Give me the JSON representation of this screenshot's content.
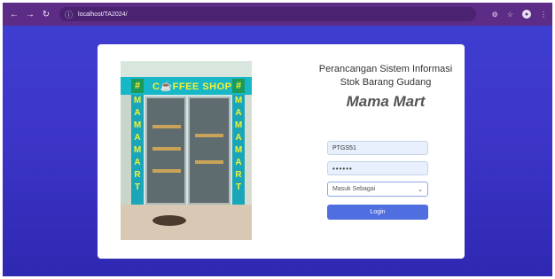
{
  "browser": {
    "url": "localhost/TA2024/",
    "icons": [
      "back-icon",
      "forward-icon",
      "reload-icon",
      "info-icon",
      "translate-icon",
      "star-icon",
      "extension-icon",
      "menu-icon"
    ],
    "bar_color": "#5d2c86"
  },
  "page": {
    "background": "#3d36c9",
    "title_line1": "Perancangan Sistem Informasi",
    "title_line2": "Stok Barang Gudang",
    "app_name": "Mama Mart",
    "photo": {
      "sign": "C☕FFEE SHOP",
      "column_text": [
        "M",
        "A",
        "M",
        "A",
        "M",
        "A",
        "R",
        "T"
      ],
      "hash": "#"
    }
  },
  "form": {
    "username_value": "PTGS51",
    "password_value": "••••••",
    "role_select": "Masuk Sebagai",
    "login_label": "Login",
    "button_color": "#4f6ee0"
  }
}
